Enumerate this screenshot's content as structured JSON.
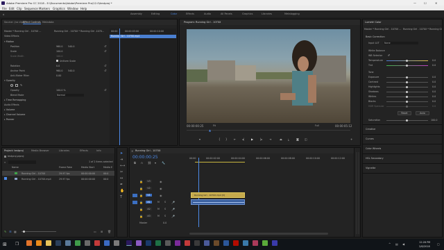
{
  "window": {
    "title": "Adobe Premiere Pro CC 2018 - E:\\Documents\\Adobe\\Premiere Pro\\12.0\\testproj *",
    "min": "—",
    "max": "☐",
    "close": "✕"
  },
  "menu": [
    "File",
    "Edit",
    "Clip",
    "Sequence",
    "Markers",
    "Graphics",
    "Window",
    "Help"
  ],
  "workspaces": [
    "Assembly",
    "Editing",
    "Color",
    "Effects",
    "Audio",
    "All Panels",
    "Graphics",
    "Libraries",
    "Metalogging"
  ],
  "workspaceActive": "Color",
  "source": {
    "tabs": [
      "Source: (no clips)",
      "Effect Controls",
      "Metadata"
    ],
    "activeTab": "Effect Controls",
    "master": "Master * Running Girl - 1070X ...",
    "seq": "Running Girl - 1070X * Running Girl -1070...",
    "videoEffects": "Video Effects",
    "clipName": "Running Girl - 1070X.mp4",
    "time1": "00:00",
    "time2": "00:00:05:00",
    "time3": "00:00:10:00",
    "motion": "Motion",
    "position": "Position",
    "posX": "960.0",
    "posY": "540.0",
    "scale": "Scale",
    "scaleV": "100.0",
    "scaleWidth": "Scale Width",
    "scaleWidthV": "100.0",
    "uniform": "Uniform Scale",
    "rotation": "Rotation",
    "rotationV": "0.0",
    "anchor": "Anchor Point",
    "anchorX": "960.0",
    "anchorY": "540.0",
    "flicker": "Anti-flicker Filter",
    "flickerV": "0.00",
    "opacityHdr": "Opacity",
    "opacity": "Opacity",
    "opacityV": "100.0 %",
    "blend": "Blend Mode",
    "blendV": "Normal",
    "timeRemap": "Time Remapping",
    "audioEffects": "Audio Effects",
    "volume": "Volume",
    "channelVol": "Channel Volume",
    "panner": "Panner"
  },
  "program": {
    "tab": "Program: Running Girl - 1070X",
    "timeL": "00:00:00:25",
    "fit": "Fit",
    "quality": "Full",
    "timeR": "00:00:05:12"
  },
  "lumetri": {
    "tab": "Lumetri Color",
    "master": "Master * Running Girl - 1070X ...",
    "seq": "Running Girl - 1070X * Running Girl...",
    "basic": "Basic Correction",
    "inputLut": "Input LUT",
    "inputLutV": "None",
    "whiteBalance": "White Balance",
    "wbSelector": "WB Selector",
    "temperature": "Temperature",
    "temperatureV": "0.0",
    "tint": "Tint",
    "tintV": "0.0",
    "tone": "Tone",
    "exposure": "Exposure",
    "exposureV": "0.0",
    "contrast": "Contrast",
    "contrastV": "0.0",
    "highlights": "Highlights",
    "highlightsV": "0.0",
    "shadows": "Shadows",
    "shadowsV": "0.0",
    "whites": "Whites",
    "whitesV": "0.0",
    "blacks": "Blacks",
    "blacksV": "0.0",
    "hdrSpec": "HDR Specular",
    "hdrSpecV": "0.0",
    "reset": "Reset",
    "auto": "Auto",
    "saturation": "Saturation",
    "saturationV": "100.0",
    "sections": [
      "Creative",
      "Curves",
      "Color Wheels",
      "HSL Secondary",
      "Vignette"
    ]
  },
  "project": {
    "tabs": [
      "Project: testproj",
      "Media Browser",
      "Libraries",
      "Effects",
      "Info"
    ],
    "path": "testproj.prproj",
    "count": "1 of 2 items selected",
    "cols": [
      "Name",
      "Frame Rate",
      "Media Start",
      "Media E"
    ],
    "items": [
      {
        "name": "Running Girl - 1070X",
        "fps": "29.97 fps",
        "start": "00:00:00:00",
        "end": "00:0"
      },
      {
        "name": "Running Girl - 1070X.mp4",
        "fps": "29.97 fps",
        "start": "00:00:00:00",
        "end": "00:0"
      }
    ]
  },
  "timeline": {
    "tab": "Running Girl - 1070X",
    "time": "00:00:00:25",
    "ruler": [
      "00:00",
      "00:00:02:00",
      "00:00:04:00",
      "00:00:06:00",
      "00:00:08:00",
      "00:00:10:00",
      "00:00:12:00",
      "00:00:14:00"
    ],
    "tracks": [
      "V3",
      "V2",
      "V1",
      "A1",
      "A2",
      "A3"
    ],
    "clipV": "Running Girl - 1070X.mp4 [V]",
    "master": "Master",
    "masterV": "0.0"
  },
  "taskbar": {
    "time": "12:26 PM",
    "date": "2/6/2018"
  }
}
